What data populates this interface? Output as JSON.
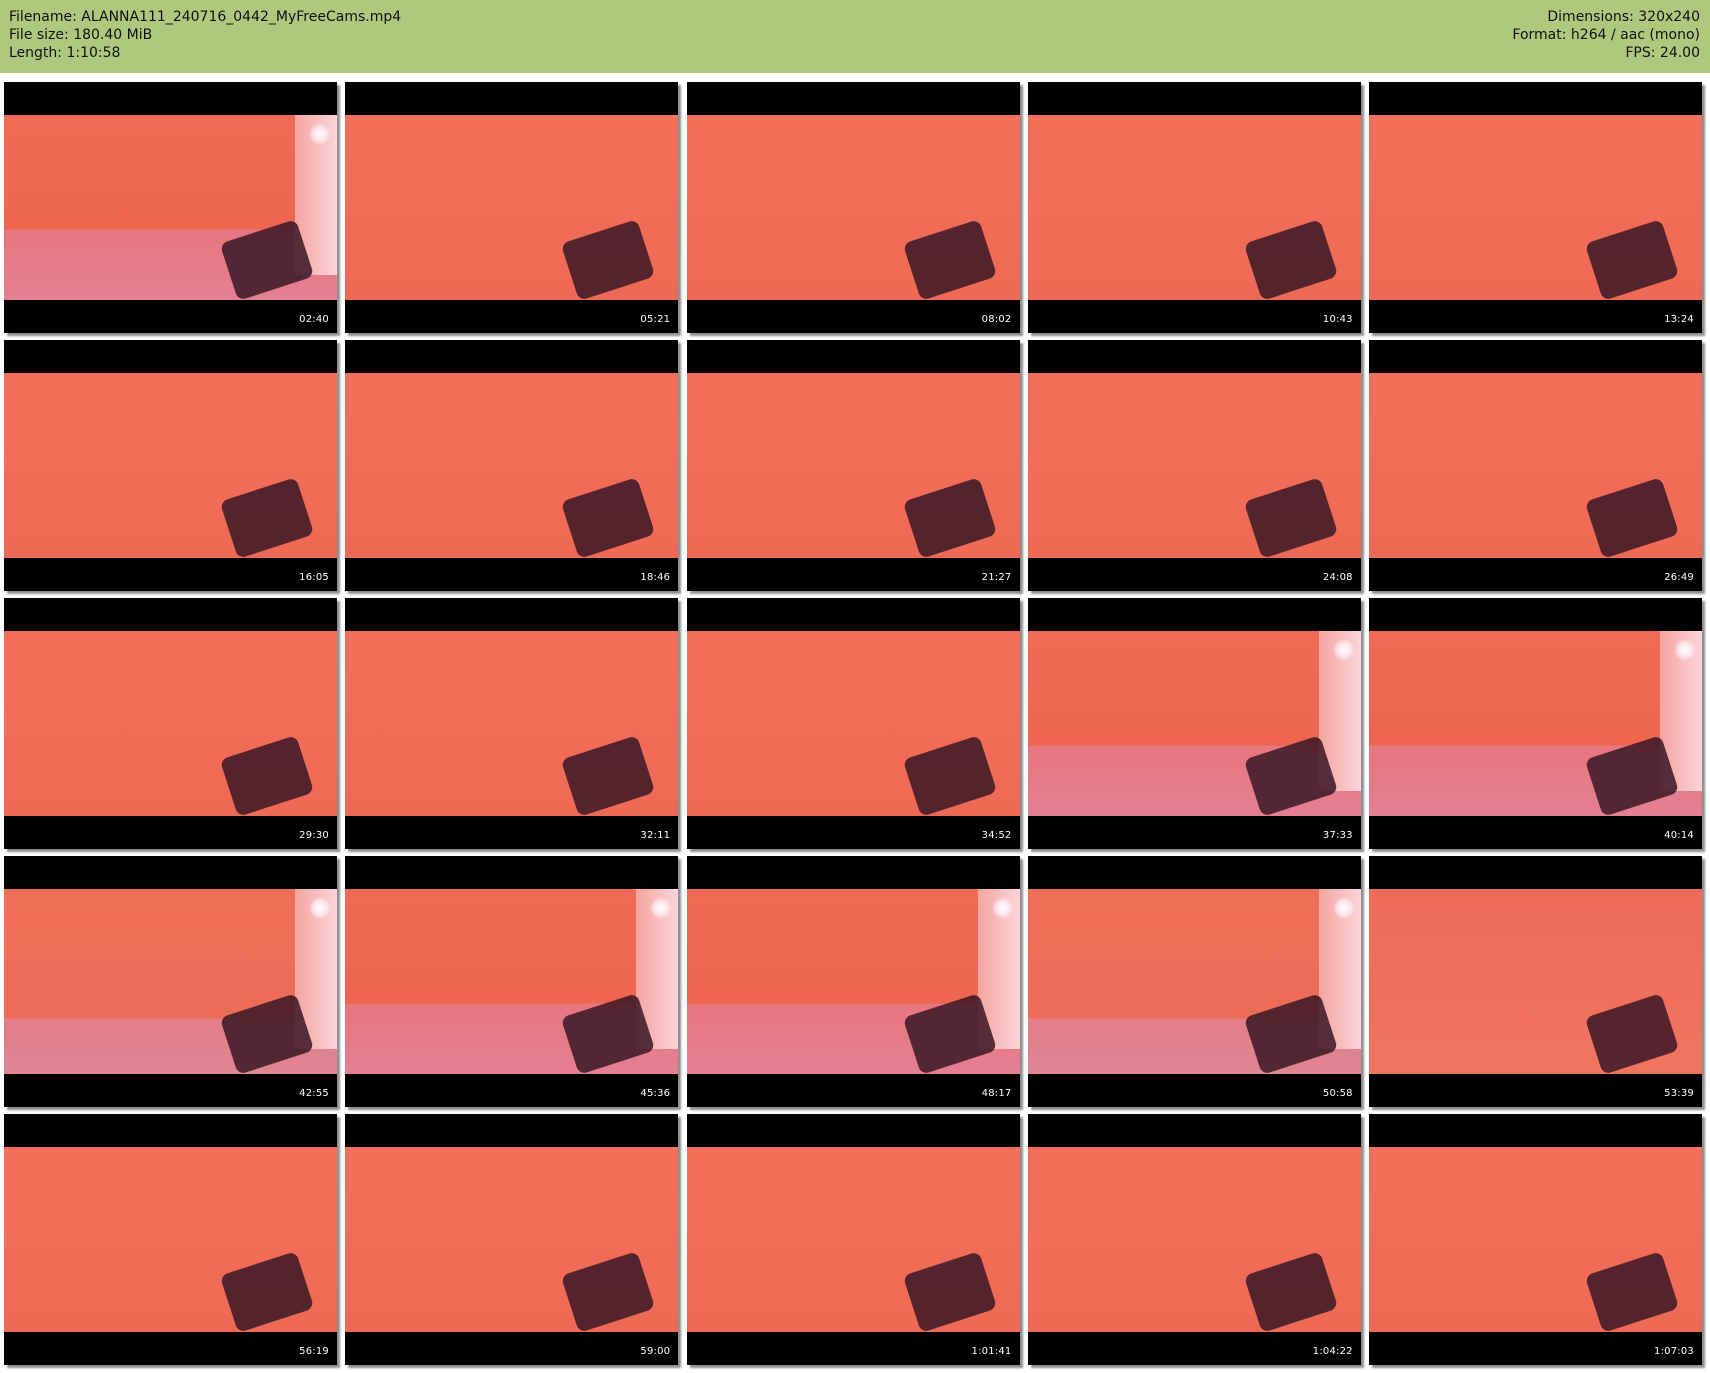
{
  "header": {
    "filename": "Filename: ALANNA111_240716_0442_MyFreeCams.mp4",
    "filesize": "File size: 180.40 MiB",
    "length": "Length: 1:10:58",
    "dimensions": "Dimensions: 320x240",
    "format": "Format: h264 / aac (mono)",
    "fps": "FPS: 24.00"
  },
  "colors": {
    "header_bg": "#aec97e",
    "letterbox": "#000000",
    "scene": "#ef6a54"
  },
  "thumbnails": [
    {
      "time": "02:40",
      "scene": "a"
    },
    {
      "time": "05:21",
      "scene": "b"
    },
    {
      "time": "08:02",
      "scene": "b"
    },
    {
      "time": "10:43",
      "scene": "b"
    },
    {
      "time": "13:24",
      "scene": "b"
    },
    {
      "time": "16:05",
      "scene": "b"
    },
    {
      "time": "18:46",
      "scene": "b"
    },
    {
      "time": "21:27",
      "scene": "b"
    },
    {
      "time": "24:08",
      "scene": "b"
    },
    {
      "time": "26:49",
      "scene": "b"
    },
    {
      "time": "29:30",
      "scene": "b"
    },
    {
      "time": "32:11",
      "scene": "b"
    },
    {
      "time": "34:52",
      "scene": "b"
    },
    {
      "time": "37:33",
      "scene": "a"
    },
    {
      "time": "40:14",
      "scene": "a"
    },
    {
      "time": "42:55",
      "scene": "c"
    },
    {
      "time": "45:36",
      "scene": "a"
    },
    {
      "time": "48:17",
      "scene": "a"
    },
    {
      "time": "50:58",
      "scene": "c"
    },
    {
      "time": "53:39",
      "scene": "d"
    },
    {
      "time": "56:19",
      "scene": "b"
    },
    {
      "time": "59:00",
      "scene": "b"
    },
    {
      "time": "1:01:41",
      "scene": "b"
    },
    {
      "time": "1:04:22",
      "scene": "b"
    },
    {
      "time": "1:07:03",
      "scene": "b"
    }
  ]
}
